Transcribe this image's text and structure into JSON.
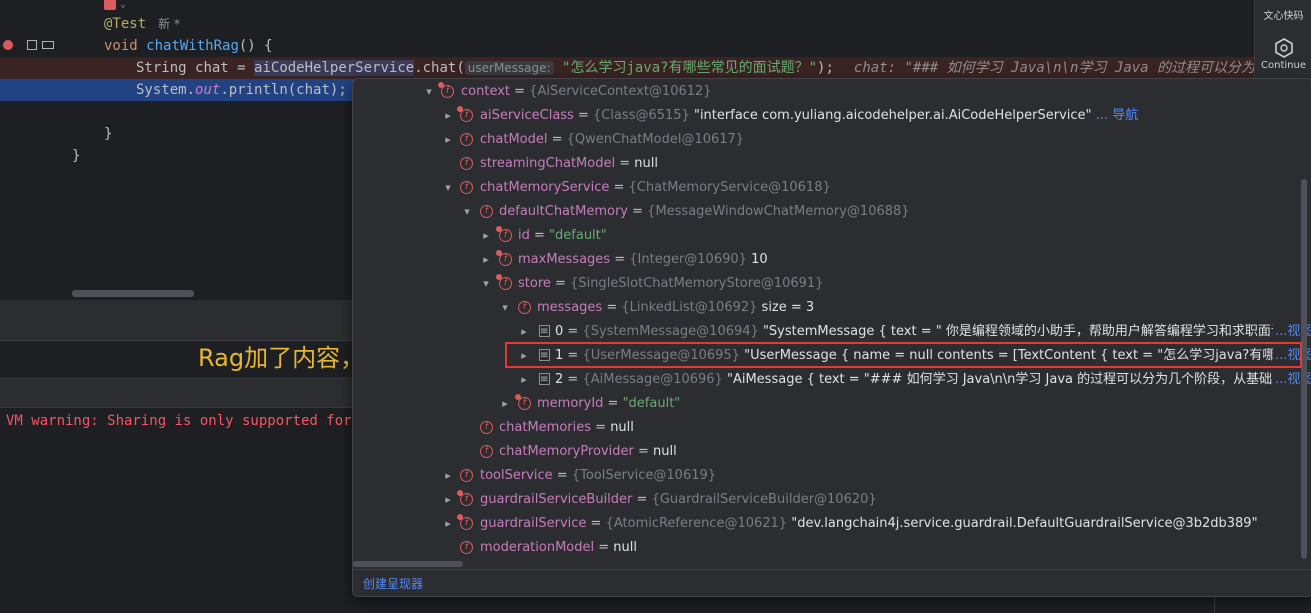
{
  "editor": {
    "annotation": "@Test",
    "badge": "新 *",
    "void_kw": "void",
    "method_name": "chatWithRag",
    "method_rest": "() {",
    "string_type": "String",
    "var_chat": "chat",
    "assign": " = ",
    "service_var": "aiCodeHelperService",
    "dot_chat": ".chat(",
    "param_hint": "userMessage:",
    "arg_string": "\"怎么学习java?有哪些常见的面试题？\"",
    "call_end": ");",
    "inline_value": "chat: \"### 如何学习 Java\\n\\n学习 Java 的过程可以分为几个阶段,",
    "print_system": "System.",
    "print_out": "out",
    "print_rest": ".println(chat);",
    "close_inner": "}",
    "close_outer": "}"
  },
  "right_panel": {
    "wenxin_label": "文心快码",
    "continue_label": "Continue"
  },
  "console": {
    "vm_warning": "VM warning: Sharing is only supported for b"
  },
  "overlay_caption": "Rag加了内容，说明生效了",
  "debug_tree": [
    {
      "name": "context",
      "ref": "{AiServiceContext@10612}",
      "value": ""
    },
    {
      "name": "aiServiceClass",
      "ref": "{Class@6515}",
      "value": "\"interface com.yuliang.aicodehelper.ai.AiCodeHelperService\"",
      "link": "... 导航"
    },
    {
      "name": "chatModel",
      "ref": "{QwenChatModel@10617}",
      "value": ""
    },
    {
      "name": "streamingChatModel",
      "ref": "",
      "value": "null"
    },
    {
      "name": "chatMemoryService",
      "ref": "{ChatMemoryService@10618}",
      "value": ""
    },
    {
      "name": "defaultChatMemory",
      "ref": "{MessageWindowChatMemory@10688}",
      "value": ""
    },
    {
      "name": "id",
      "ref": "",
      "value": "\"default\""
    },
    {
      "name": "maxMessages",
      "ref": "{Integer@10690}",
      "value": "10"
    },
    {
      "name": "store",
      "ref": "{SingleSlotChatMemoryStore@10691}",
      "value": ""
    },
    {
      "name": "messages",
      "ref": "{LinkedList@10692}",
      "value": " size = 3"
    },
    {
      "name": "0",
      "ref": "{SystemMessage@10694}",
      "value": "\"SystemMessage { text = \" 你是编程领域的小助手，帮助用户解答编程学习和求职面试相关的问题，",
      "link": "...视图"
    },
    {
      "name": "1",
      "ref": "{UserMessage@10695}",
      "value": "\"UserMessage { name = null contents = [TextContent { text = \"怎么学习java?有哪些常见的面试题?",
      "link": "...视图"
    },
    {
      "name": "2",
      "ref": "{AiMessage@10696}",
      "value": "\"AiMessage { text = \"### 如何学习 Java\\n\\n学习 Java 的过程可以分为几个阶段，从基础到进阶，逐步深",
      "link": "...视图"
    },
    {
      "name": "memoryId",
      "ref": "",
      "value": "\"default\""
    },
    {
      "name": "chatMemories",
      "ref": "",
      "value": "null"
    },
    {
      "name": "chatMemoryProvider",
      "ref": "",
      "value": "null"
    },
    {
      "name": "toolService",
      "ref": "{ToolService@10619}",
      "value": ""
    },
    {
      "name": "guardrailServiceBuilder",
      "ref": "{GuardrailServiceBuilder@10620}",
      "value": ""
    },
    {
      "name": "guardrailService",
      "ref": "{AtomicReference@10621}",
      "value": "\"dev.langchain4j.service.guardrail.DefaultGuardrailService@3b2db389\""
    },
    {
      "name": "moderationModel",
      "ref": "",
      "value": "null"
    }
  ],
  "popup_footer": {
    "label": "创建呈现器"
  }
}
